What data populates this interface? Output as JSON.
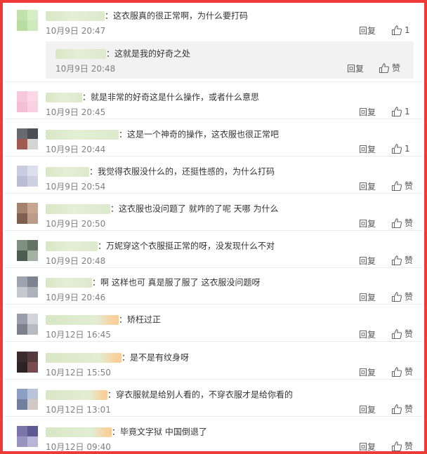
{
  "actions": {
    "reply": "回复",
    "like": "赞"
  },
  "comments": [
    {
      "text": "：这衣服真的很正常啊，为什么要打码",
      "time": "10月9日 20:47",
      "likes": "1",
      "avatar": [
        "#c2e1ad",
        "#d6edc6",
        "#b9dca2",
        "#cfe8bd"
      ],
      "blur": 84,
      "blurStyle": "",
      "reply": {
        "text": "：这就是我的好奇之处",
        "time": "10月9日 20:48",
        "likes": "",
        "blur": 72
      }
    },
    {
      "text": "：就是非常的好奇这是什么操作，或者什么意思",
      "time": "10月9日 20:45",
      "likes": "1",
      "avatar": [
        "#f7c7da",
        "#fbd8e6",
        "#f3bfd3",
        "#f9d1e1"
      ],
      "blur": 52,
      "blurStyle": ""
    },
    {
      "text": "：这是一个神奇的操作，这衣服也很正常吧",
      "time": "10月9日 20:44",
      "likes": "1",
      "avatar": [
        "#676a6f",
        "#4b4e55",
        "#a05a52",
        "#d4d4d4"
      ],
      "blur": 104,
      "blurStyle": ""
    },
    {
      "text": "：我觉得衣服没什么的，还挺性感的，为什么打码",
      "time": "10月9日 20:54",
      "likes": "",
      "avatar": [
        "#c9cde0",
        "#dde0ec",
        "#b9bed4",
        "#cdd1e2"
      ],
      "blur": 62,
      "blurStyle": ""
    },
    {
      "text": "：这衣服也没问题了  就咋的了呢  天哪  为什么",
      "time": "10月9日 20:50",
      "likes": "",
      "avatar": [
        "#a38270",
        "#c7a58f",
        "#7d604f",
        "#bc9c86"
      ],
      "blur": 92,
      "blurStyle": ""
    },
    {
      "text": "：万妮穿这个衣服挺正常的呀，没发现什么不对",
      "time": "10月9日 20:48",
      "likes": "",
      "avatar": [
        "#7f8f80",
        "#637463",
        "#4d5d4f",
        "#a3b2a3"
      ],
      "blur": 74,
      "blurStyle": ""
    },
    {
      "text": "：啊  这样也可  真是服了服了  这衣服没问题呀",
      "time": "10月9日 20:46",
      "likes": "",
      "avatar": [
        "#9ea3ad",
        "#7d8390",
        "#c5c8cf",
        "#aeb2ba"
      ],
      "blur": 66,
      "blurStyle": ""
    },
    {
      "text": "：矫枉过正",
      "time": "10月12日 16:45",
      "likes": "",
      "avatar": [
        "#9b9ea8",
        "#d2d4da",
        "#7e818b",
        "#b8bac1"
      ],
      "blur": 104,
      "blurStyle": "o"
    },
    {
      "text": "：是不是有纹身呀",
      "time": "10月12日 15:50",
      "likes": "",
      "avatar": [
        "#3a2b2d",
        "#563a3d",
        "#2d2224",
        "#7a4b4e"
      ],
      "blur": 108,
      "blurStyle": "o"
    },
    {
      "text": "：穿衣服就是给别人看的，不穿衣服才是给你看的",
      "time": "10月12日 13:01",
      "likes": "",
      "avatar": [
        "#8c9fc2",
        "#b9c4d8",
        "#6f7f9c",
        "#d2c8c6"
      ],
      "blur": 88,
      "blurStyle": "o"
    },
    {
      "text": "：毕竟文字狱  中国倒退了",
      "time": "10月12日 09:40",
      "likes": "",
      "avatar": [
        "#7a76a8",
        "#5d5991",
        "#9893bf",
        "#b9b5d6"
      ],
      "blur": 94,
      "blurStyle": "o"
    }
  ]
}
